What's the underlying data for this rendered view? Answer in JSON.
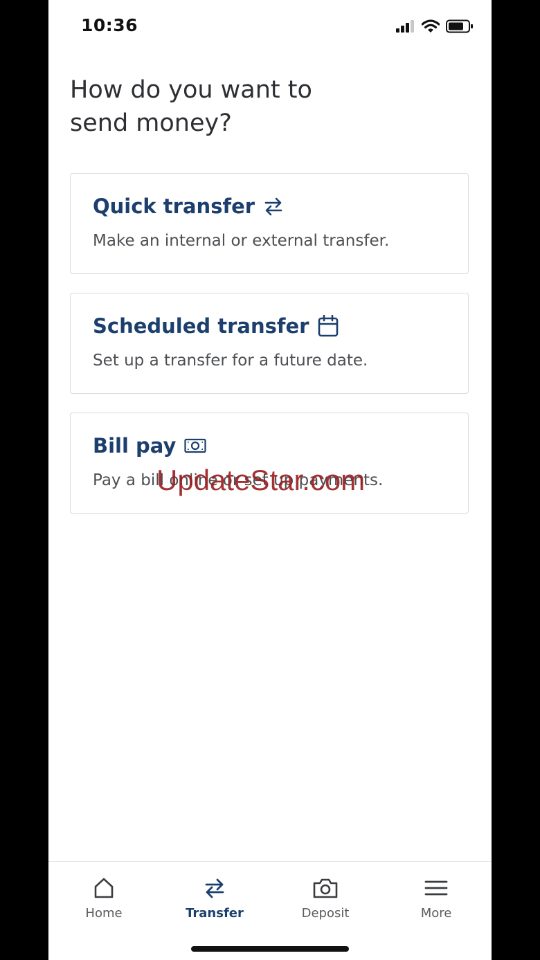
{
  "status": {
    "time": "10:36"
  },
  "page": {
    "title": "How do you want to send money?"
  },
  "options": [
    {
      "title": "Quick transfer",
      "description": "Make an internal or external transfer.",
      "icon": "transfer-arrows-icon"
    },
    {
      "title": "Scheduled transfer",
      "description": "Set up a transfer for a future date.",
      "icon": "calendar-icon"
    },
    {
      "title": "Bill pay",
      "description": "Pay a bill online or set up payments.",
      "icon": "cash-icon"
    }
  ],
  "watermark": "UpdateStar.com",
  "tabs": [
    {
      "label": "Home",
      "icon": "home-icon",
      "active": false
    },
    {
      "label": "Transfer",
      "icon": "transfer-arrows-icon",
      "active": true
    },
    {
      "label": "Deposit",
      "icon": "camera-icon",
      "active": false
    },
    {
      "label": "More",
      "icon": "menu-icon",
      "active": false
    }
  ],
  "colors": {
    "accent": "#1c3f6e",
    "text": "#2d2f33",
    "watermark": "#9a1c1f"
  }
}
